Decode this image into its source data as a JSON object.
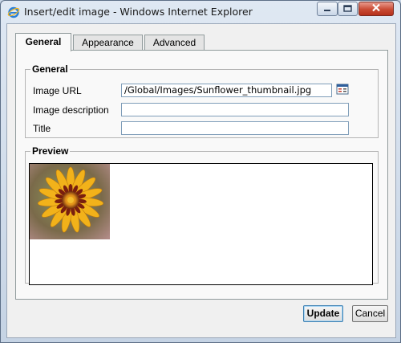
{
  "window": {
    "title": "Insert/edit image - Windows Internet Explorer",
    "app_icon": "internet-explorer-icon",
    "controls": [
      "minimize-icon",
      "maximize-icon",
      "close-icon"
    ]
  },
  "tabs": [
    {
      "label": "General",
      "active": true
    },
    {
      "label": "Appearance",
      "active": false
    },
    {
      "label": "Advanced",
      "active": false
    }
  ],
  "general": {
    "legend": "General",
    "image_url_label": "Image URL",
    "image_url_value": "/Global/Images/Sunflower_thumbnail.jpg",
    "image_description_label": "Image description",
    "image_description_value": "",
    "title_label": "Title",
    "title_value": "",
    "browse_icon": "browse-image-icon"
  },
  "preview": {
    "legend": "Preview",
    "image": "sunflower-thumbnail"
  },
  "buttons": {
    "update": "Update",
    "cancel": "Cancel"
  },
  "colors": {
    "title_bar": "#dfe8f3",
    "close_button": "#c94a33",
    "dialog_bg": "#f0f0f0",
    "input_border": "#7f9db9"
  }
}
